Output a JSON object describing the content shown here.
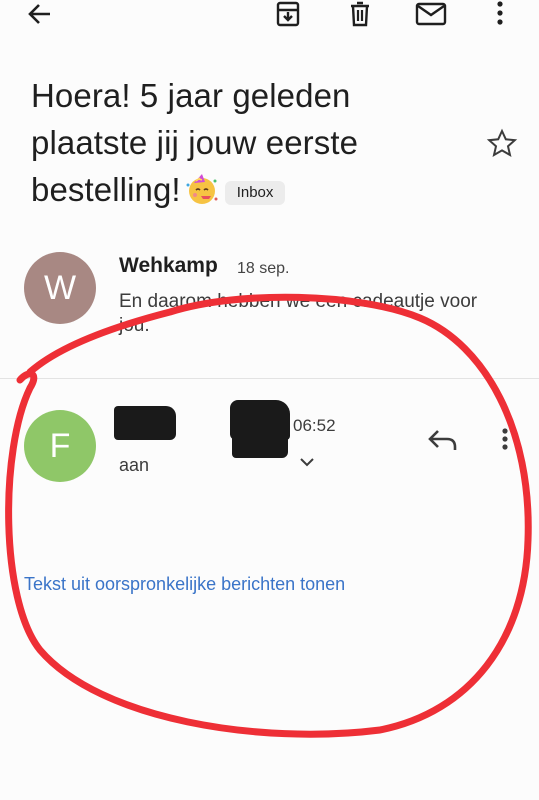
{
  "toolbar": {
    "back_icon": "arrow-back-icon",
    "archive_icon": "archive-icon",
    "delete_icon": "trash-icon",
    "mark_unread_icon": "mail-icon",
    "more_icon": "more-vert-icon"
  },
  "email": {
    "subject": "Hoera! 5 jaar geleden plaatste jij jouw eerste bestelling!",
    "subject_emoji": "party-face-emoji",
    "label": "Inbox"
  },
  "messages": [
    {
      "avatar_letter": "W",
      "avatar_color": "#a88883",
      "sender": "Wehkamp",
      "date": "18 sep.",
      "snippet": "En daarom hebben we een cadeautje voor jou."
    },
    {
      "avatar_letter": "F",
      "avatar_color": "#8fc768",
      "time": "06:52",
      "to_prefix": "aan"
    }
  ],
  "show_original_link": "Tekst uit oorspronkelijke berichten tonen",
  "colors": {
    "link": "#3a74c8",
    "annotation": "#ee2f36"
  }
}
